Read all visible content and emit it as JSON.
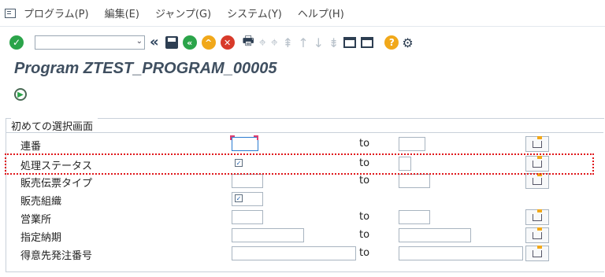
{
  "menu": {
    "items": [
      "プログラム(P)",
      "編集(E)",
      "ジャンプ(G)",
      "システム(Y)",
      "ヘルプ(H)"
    ]
  },
  "toolbar": {
    "command_value": "",
    "ok_icon": "check-icon",
    "colors": {
      "ok": "#2ba44a",
      "back": "#2ba44a",
      "exit": "#f1a81a",
      "cancel": "#d83a2a",
      "help": "#f1a81a"
    }
  },
  "title": "Program ZTEST_PROGRAM_00005",
  "selection": {
    "frame_title": "初めての選択画面",
    "to_label": "to",
    "rows": [
      {
        "label": "連番",
        "low": "",
        "high": "",
        "has_to": true,
        "has_multi": true
      },
      {
        "label": "処理ステータス",
        "low_checked": true,
        "has_to": true,
        "has_multi": true
      },
      {
        "label": "販売伝票タイプ",
        "low": "",
        "high": "",
        "has_to": true,
        "has_multi": true
      },
      {
        "label": "販売組織",
        "low_checked": true,
        "has_to": false,
        "has_multi": false
      },
      {
        "label": "営業所",
        "low": "",
        "high": "",
        "has_to": true,
        "has_multi": true
      },
      {
        "label": "指定納期",
        "low": "",
        "high": "",
        "has_to": true,
        "has_multi": true
      },
      {
        "label": "得意先発注番号",
        "low": "",
        "high": "",
        "has_to": true,
        "has_multi": true
      }
    ]
  },
  "highlight_color": "#e0181c"
}
